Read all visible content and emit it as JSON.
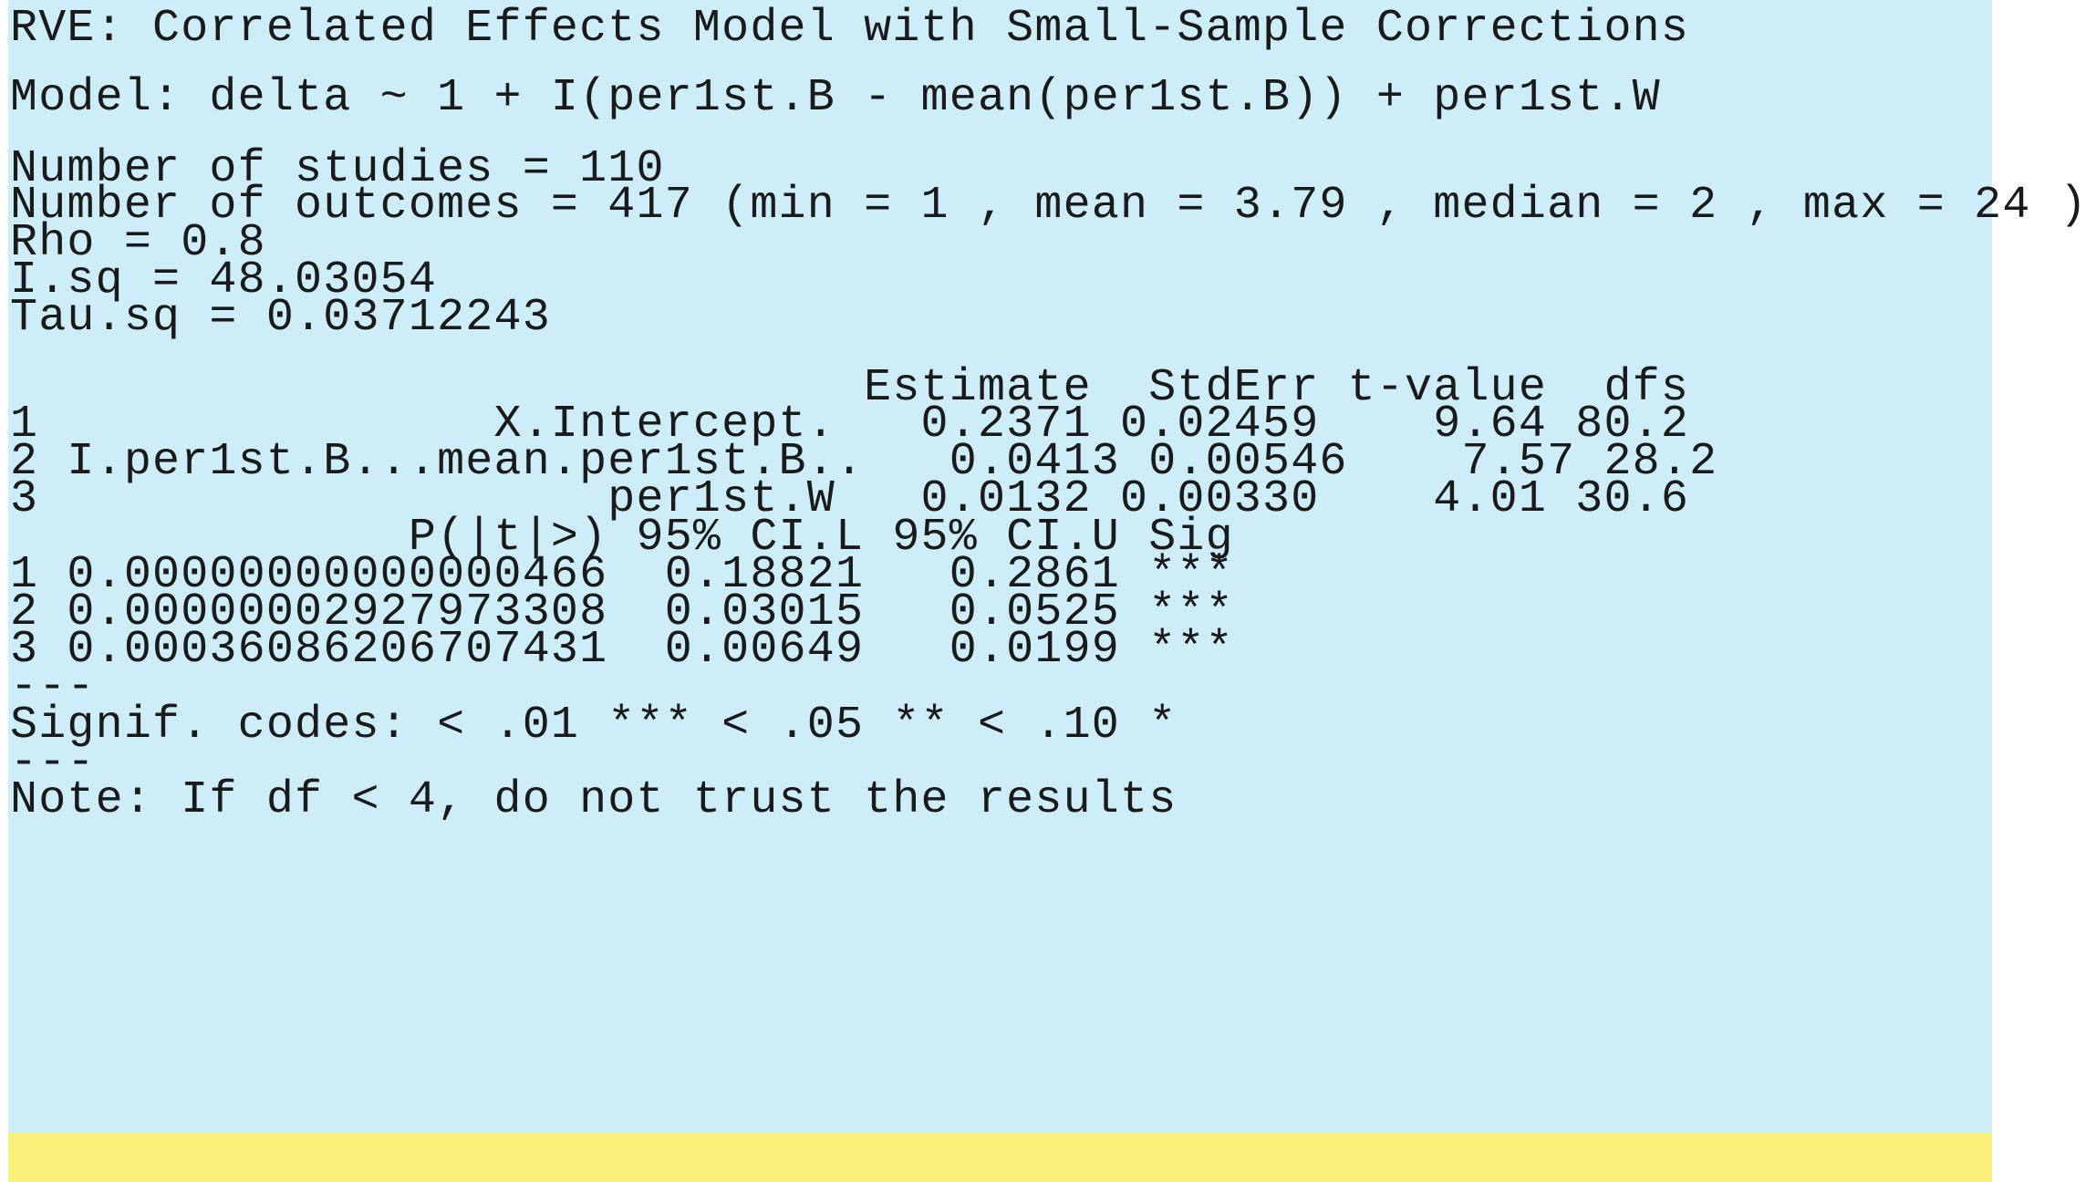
{
  "colors": {
    "panel_background": "#cdeef9",
    "note_highlight": "#fbf07a",
    "text": "#1a1a1a",
    "page_background": "#ffffff"
  },
  "output": {
    "title": "RVE: Correlated Effects Model with Small-Sample Corrections",
    "model": "Model: delta ~ 1 + I(per1st.B - mean(per1st.B)) + per1st.W",
    "n_studies": "Number of studies = 110",
    "n_outcomes": "Number of outcomes = 417 (min = 1 , mean = 3.79 , median = 2 , max = 24 )",
    "rho": "Rho = 0.8",
    "i_sq": "I.sq = 48.03054",
    "tau_sq": "Tau.sq = 0.03712243",
    "table1_header": "                              Estimate  StdErr t-value  dfs",
    "table1_rows": [
      "1                X.Intercept.   0.2371 0.02459    9.64 80.2",
      "2 I.per1st.B...mean.per1st.B..   0.0413 0.00546    7.57 28.2",
      "3                    per1st.W   0.0132 0.00330    4.01 30.6"
    ],
    "table2_header": "              P(|t|>) 95% CI.L 95% CI.U Sig",
    "table2_rows": [
      "1 0.00000000000000466  0.18821   0.2861 ***",
      "2 0.00000002927973308  0.03015   0.0525 ***",
      "3 0.00036086206707431  0.00649   0.0199 ***"
    ],
    "separator_1": "---",
    "signif_codes": "Signif. codes: < .01 *** < .05 ** < .10 *",
    "separator_2": "---",
    "note": "Note: If df < 4, do not trust the results"
  }
}
